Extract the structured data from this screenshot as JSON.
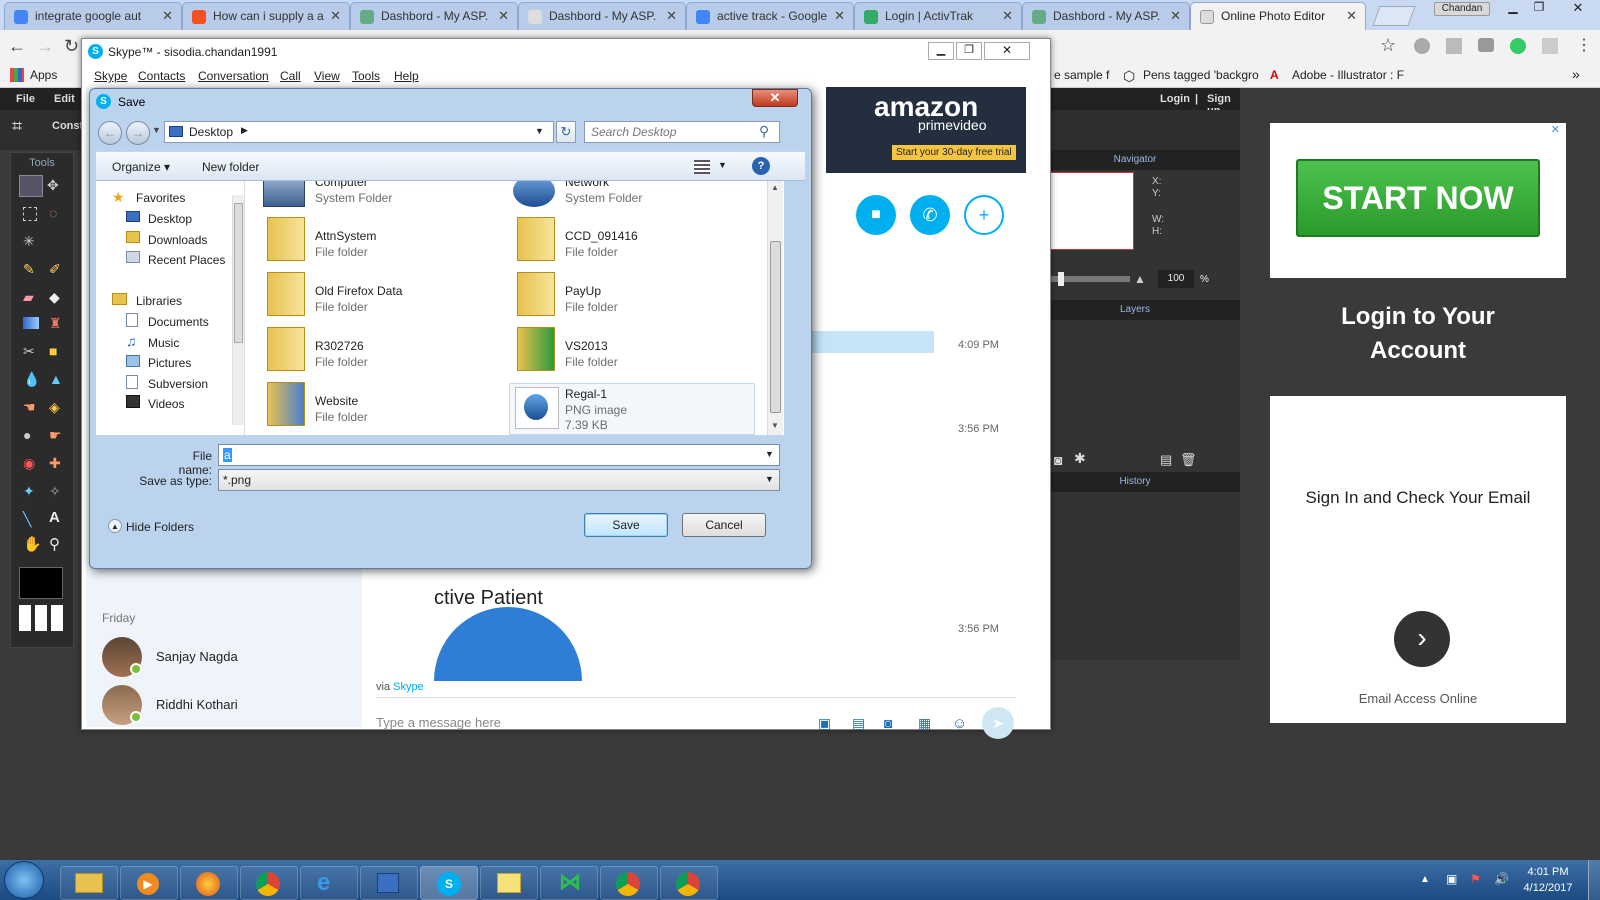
{
  "browser": {
    "tabs": [
      {
        "label": "integrate google aut",
        "color": "#4285f4"
      },
      {
        "label": "How can i supply a a",
        "color": "#f25022"
      },
      {
        "label": "Dashbord - My ASP.",
        "color": "#6a8"
      },
      {
        "label": "Dashbord - My ASP.",
        "color": "#ddd"
      },
      {
        "label": "active track - Google",
        "color": "#4285f4"
      },
      {
        "label": "Login | ActivTrak",
        "color": "#3a6"
      },
      {
        "label": "Dashbord - My ASP.",
        "color": "#6a8"
      },
      {
        "label": "Online Photo Editor",
        "color": "#ddd"
      }
    ],
    "profile": "Chandan",
    "bookmarks": {
      "apps": "Apps",
      "item1": "e sample f",
      "item2": "Pens tagged 'backgro",
      "item3": "Adobe - Illustrator : F"
    }
  },
  "photo_editor": {
    "menu": {
      "file": "File",
      "edit": "Edit"
    },
    "sub_label": "Const",
    "login": "Login",
    "sep": "|",
    "signup": "Sign up",
    "tools_title": "Tools",
    "navigator": "Navigator",
    "x": "X:",
    "y": "Y:",
    "w": "W:",
    "h": "H:",
    "zoom": "100",
    "percent": "%",
    "layers": "Layers",
    "history": "History"
  },
  "ad": {
    "start": "START NOW",
    "login_title": "Login to Your Account",
    "sign_in": "Sign In and Check Your Email",
    "footer": "Email Access Online",
    "close": "✕"
  },
  "skype": {
    "title": "Skype™ - sisodia.chandan1991",
    "menu": [
      "Skype",
      "Contacts",
      "Conversation",
      "Call",
      "View",
      "Tools",
      "Help"
    ],
    "amazon": "amazon",
    "prime": "primevideo",
    "trial": "Start your 30-day free trial",
    "times": [
      "4:09 PM",
      "3:56 PM",
      "3:56 PM"
    ],
    "day": "Friday",
    "contacts": [
      "Sanjay Nagda",
      "Riddhi Kothari"
    ],
    "active_patient": "ctive Patient",
    "via": "via",
    "via_link": "Skype",
    "message_placeholder": "Type a message here"
  },
  "dialog": {
    "title": "Save",
    "location": "Desktop",
    "search_placeholder": "Search Desktop",
    "organize": "Organize ▾",
    "new_folder": "New folder",
    "nav": {
      "favorites": "Favorites",
      "fav_items": [
        "Desktop",
        "Downloads",
        "Recent Places"
      ],
      "libraries": "Libraries",
      "lib_items": [
        "Documents",
        "Music",
        "Pictures",
        "Subversion",
        "Videos"
      ]
    },
    "items": [
      {
        "name": "Computer",
        "type": "System Folder"
      },
      {
        "name": "Network",
        "type": "System Folder"
      },
      {
        "name": "AttnSystem",
        "type": "File folder"
      },
      {
        "name": "CCD_091416",
        "type": "File folder"
      },
      {
        "name": "Old Firefox Data",
        "type": "File folder"
      },
      {
        "name": "PayUp",
        "type": "File folder"
      },
      {
        "name": "R302726",
        "type": "File folder"
      },
      {
        "name": "VS2013",
        "type": "File folder"
      },
      {
        "name": "Website",
        "type": "File folder"
      },
      {
        "name": "Regal-1",
        "type": "PNG image",
        "size": "7.39 KB"
      }
    ],
    "file_name_label": "File name:",
    "file_name_value": "a",
    "save_type_label": "Save as type:",
    "save_type_value": "*.png",
    "hide_folders": "Hide Folders",
    "save": "Save",
    "cancel": "Cancel"
  },
  "taskbar": {
    "time": "4:01 PM",
    "date": "4/12/2017"
  }
}
